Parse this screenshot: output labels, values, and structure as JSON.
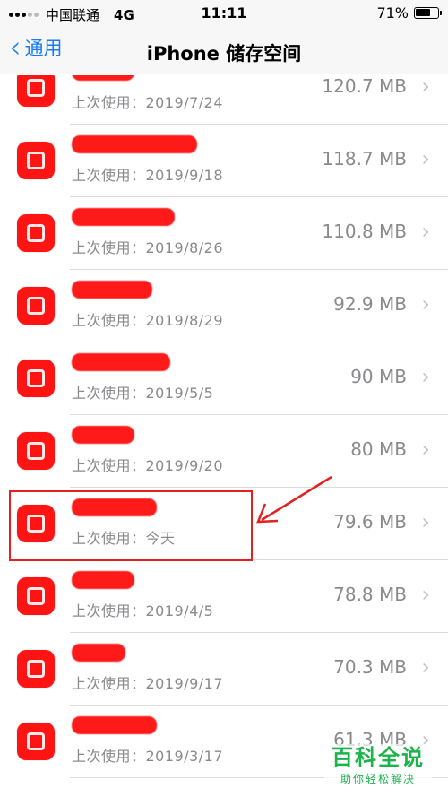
{
  "status_bar": {
    "carrier": "中国联通",
    "network": "4G",
    "time": "11:11",
    "battery_percent": "71%",
    "battery_level": 0.71
  },
  "nav": {
    "back_label": "通用",
    "title": "iPhone 储存空间"
  },
  "apps": [
    {
      "last_used": "上次使用：2019/7/24",
      "size": "120.7 MB"
    },
    {
      "last_used": "上次使用：2019/9/18",
      "size": "118.7 MB"
    },
    {
      "last_used": "上次使用：2019/8/26",
      "size": "110.8 MB"
    },
    {
      "last_used": "上次使用：2019/8/29",
      "size": "92.9 MB"
    },
    {
      "last_used": "上次使用：2019/5/5",
      "size": "90 MB"
    },
    {
      "last_used": "上次使用：2019/9/20",
      "size": "80 MB"
    },
    {
      "last_used": "上次使用：今天",
      "size": "79.6 MB"
    },
    {
      "last_used": "上次使用：2019/4/5",
      "size": "78.8 MB"
    },
    {
      "last_used": "上次使用：2019/9/17",
      "size": "70.3 MB"
    },
    {
      "last_used": "上次使用：2019/3/17",
      "size": "61.3 MB"
    }
  ],
  "watermark": {
    "main": "百科全说",
    "sub": "助你轻松解决"
  },
  "colors": {
    "accent": "#1a7cf5",
    "redaction": "#ff1a1a",
    "annotation": "#e52020",
    "watermark": "#1bb34a"
  }
}
